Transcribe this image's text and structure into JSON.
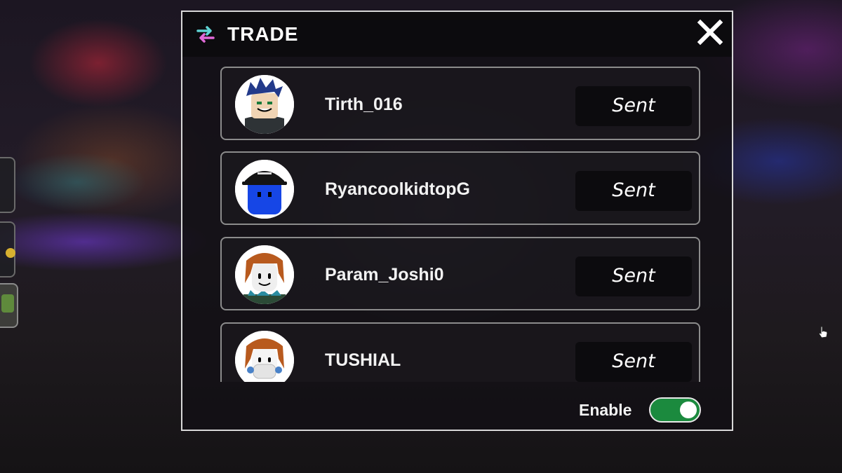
{
  "dialog": {
    "title": "TRADE",
    "icon": "swap-arrows-icon",
    "close_icon": "close-icon"
  },
  "players": [
    {
      "username": "Tirth_016",
      "status": "Sent",
      "avatar": "blue-spiky-hair-avatar"
    },
    {
      "username": "RyancoolkidtopG",
      "status": "Sent",
      "avatar": "blue-cap-avatar"
    },
    {
      "username": "Param_Joshi0",
      "status": "Sent",
      "avatar": "brown-hair-smile-avatar"
    },
    {
      "username": "TUSHIAL",
      "status": "Sent",
      "avatar": "brown-hair-mask-avatar"
    }
  ],
  "footer": {
    "enable_label": "Enable",
    "enabled": true
  },
  "colors": {
    "toggle_on": "#1b8a3e",
    "icon_teal": "#5fd4d4",
    "icon_pink": "#e06ad8"
  }
}
